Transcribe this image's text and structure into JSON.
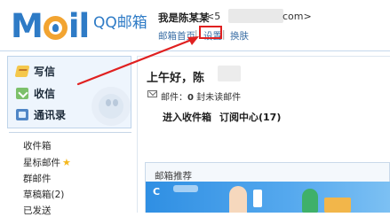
{
  "header": {
    "logo_text_left": "M",
    "logo_text_right": "il",
    "logo_qq": "QQ邮箱",
    "user_name": "我是陈某某",
    "email_prefix": "<5",
    "email_suffix": "com>",
    "nav": {
      "home": "邮箱首页",
      "separator": "|",
      "settings": "设置",
      "skin": "换肤"
    }
  },
  "sidebar": {
    "tools": [
      {
        "label": "写信",
        "icon": "pencil-icon"
      },
      {
        "label": "收信",
        "icon": "inbox-icon"
      },
      {
        "label": "通讯录",
        "icon": "contacts-icon"
      }
    ],
    "folders": [
      {
        "label": "收件箱"
      },
      {
        "label": "星标邮件"
      },
      {
        "label": "群邮件"
      },
      {
        "label": "草稿箱(2)"
      },
      {
        "label": "已发送"
      }
    ]
  },
  "main": {
    "greeting": "上午好，陈",
    "mail_stat_prefix": "邮件：",
    "mail_stat_count": "0",
    "mail_stat_suffix": " 封未读邮件",
    "links": {
      "inbox": "进入收件箱",
      "subscriptions": "订阅中心(17)"
    },
    "recommend": {
      "title": "邮箱推荐",
      "banner_letter": "C"
    }
  },
  "colors": {
    "brand_blue": "#2e7bc6",
    "logo_orange": "#f2a431",
    "highlight_red": "#e02020",
    "link_blue": "#3a6ea5",
    "star_yellow": "#f5b81d"
  }
}
